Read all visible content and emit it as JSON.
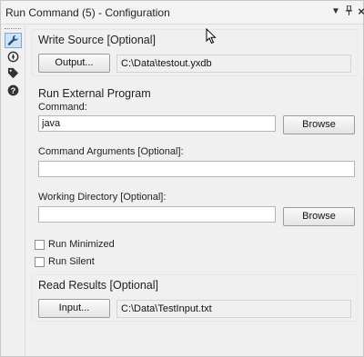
{
  "window": {
    "title": "Run Command (5) - Configuration",
    "controls": {
      "menu": "▾",
      "pin": "📌",
      "close": "×"
    }
  },
  "sidebar": {
    "items": [
      {
        "icon": "wrench-icon",
        "active": true
      },
      {
        "icon": "compass-icon",
        "active": false
      },
      {
        "icon": "tag-icon",
        "active": false
      },
      {
        "icon": "help-icon",
        "active": false
      }
    ]
  },
  "write_source": {
    "title": "Write Source [Optional]",
    "button_label": "Output...",
    "path": "C:\\Data\\testout.yxdb"
  },
  "external_program": {
    "title": "Run External Program",
    "command_label": "Command:",
    "command_value": "java",
    "command_browse": "Browse",
    "args_label": "Command Arguments [Optional]:",
    "args_value": "",
    "workdir_label": "Working Directory [Optional]:",
    "workdir_value": "",
    "workdir_browse": "Browse"
  },
  "options": {
    "run_minimized": {
      "label": "Run Minimized",
      "checked": false
    },
    "run_silent": {
      "label": "Run Silent",
      "checked": false
    }
  },
  "read_results": {
    "title": "Read Results [Optional]",
    "button_label": "Input...",
    "path": "C:\\Data\\TestInput.txt"
  }
}
